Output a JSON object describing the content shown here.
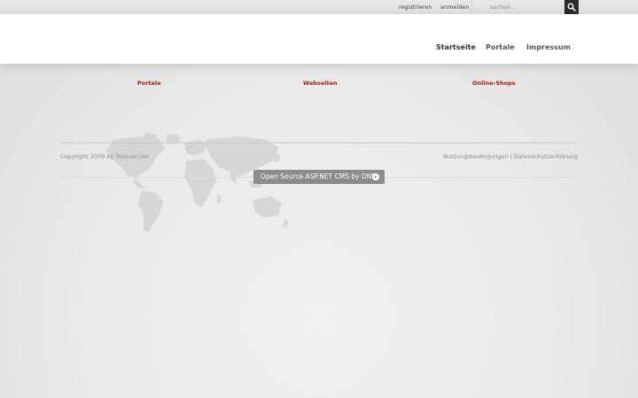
{
  "topbar": {
    "register_label": "registrieren",
    "login_label": "anmelden",
    "search_placeholder": "suchen..."
  },
  "nav": {
    "items": [
      {
        "label": "Startseite",
        "active": true
      },
      {
        "label": "Portale",
        "active": false
      },
      {
        "label": "Impressum",
        "active": false
      }
    ]
  },
  "content": {
    "links": [
      {
        "label": "Portale"
      },
      {
        "label": "Webseiten"
      },
      {
        "label": "Online-Shops"
      }
    ]
  },
  "footer": {
    "copyright": "Copyright 2009 by Stoever.net",
    "terms_label": "Nutzungsbedingungen",
    "separator": "|",
    "privacy_label": "Datenschutzerklärung",
    "dnn_button_label": "Open Source ASP.NET CMS by DNN"
  },
  "colors": {
    "accent_link": "#a01c10",
    "search_button": "#2b2b2b",
    "dnn_button": "#8c8c8c"
  },
  "icons": {
    "search": "magnifier-icon",
    "dnn_arrow": "arrow-circle-icon",
    "map": "world-map-icon"
  }
}
